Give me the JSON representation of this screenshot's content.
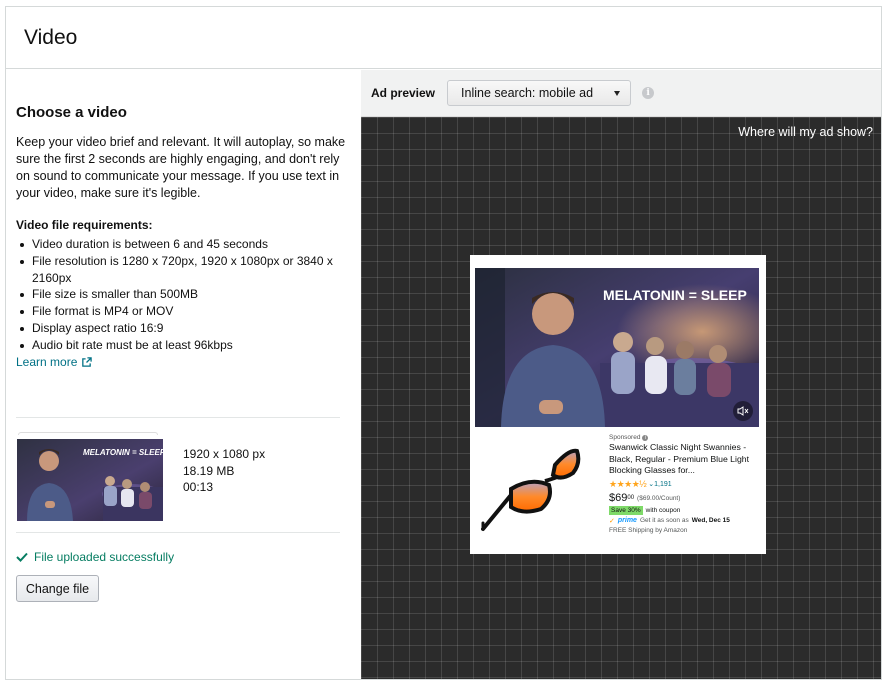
{
  "header": {
    "title": "Video"
  },
  "left": {
    "title": "Choose a video",
    "intro": "Keep your video brief and relevant. It will autoplay, so make sure the first 2 seconds are highly engaging, and don't rely on sound to communicate your message. If you use text in your video, make sure it's legible.",
    "requirements_title": "Video file requirements:",
    "requirements": [
      "Video duration is between 6 and 45 seconds",
      "File resolution is 1280 x 720px, 1920 x 1080px or 3840 x 2160px",
      "File size is smaller than 500MB",
      "File format is MP4 or MOV",
      "Display aspect ratio 16:9",
      "Audio bit rate must be at least 96kbps"
    ],
    "learn_more": "Learn more",
    "file": {
      "resolution": "1920 x 1080 px",
      "size": "18.19 MB",
      "duration": "00:13"
    },
    "upload_status": "File uploaded successfully",
    "change_button": "Change file"
  },
  "preview": {
    "label": "Ad preview",
    "selected_option": "Inline search: mobile ad",
    "where_link": "Where will my ad show?",
    "video_caption": "MELATONIN = SLEEP",
    "product": {
      "sponsored": "Sponsored",
      "title": "Swanwick Classic Night Swannies - Black, Regular - Premium Blue Light Blocking Glasses for...",
      "stars": "★★★★½",
      "rating_count": "1,191",
      "price_dollars": "$69",
      "price_cents": "00",
      "per_count": "($69.00/Count)",
      "coupon_badge": "Save 30%",
      "coupon_text": "with coupon",
      "prime": "prime",
      "delivery_prefix": "Get it as soon as",
      "delivery_date": "Wed, Dec 15",
      "shipping": "FREE Shipping by Amazon"
    }
  },
  "colors": {
    "link": "#007185",
    "success": "#067d62",
    "canvas": "#2b2b2b",
    "star": "#ffa41c",
    "coupon": "#7fda69",
    "prime": "#1399ff"
  }
}
